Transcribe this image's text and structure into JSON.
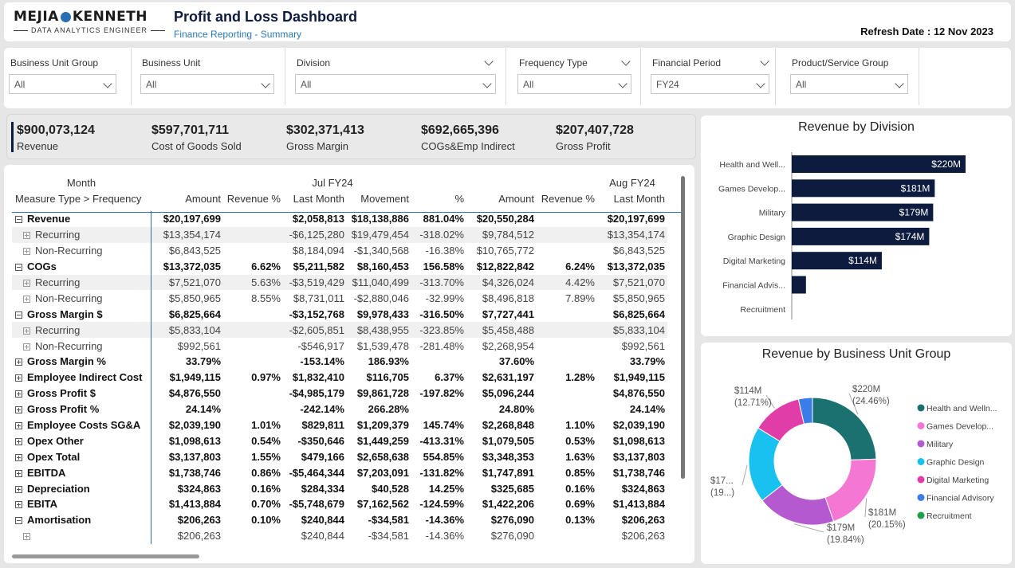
{
  "header": {
    "logo_main_left": "MEJIA",
    "logo_main_right": "KENNETH",
    "logo_sub": "DATA ANALYTICS ENGINEER",
    "title": "Profit and Loss Dashboard",
    "subtitle": "Finance Reporting - Summary",
    "refresh_label": "Refresh Date :",
    "refresh_value": "12 Nov 2023"
  },
  "slicers": [
    {
      "label": "Business Unit Group",
      "value": "All"
    },
    {
      "label": "Business Unit",
      "value": "All"
    },
    {
      "label": "Division",
      "value": "All"
    },
    {
      "label": "Frequency Type",
      "value": "All"
    },
    {
      "label": "Financial Period",
      "value": "FY24"
    },
    {
      "label": "Product/Service Group",
      "value": "All"
    }
  ],
  "kpis": [
    {
      "value": "$900,073,124",
      "label": "Revenue"
    },
    {
      "value": "$597,701,711",
      "label": "Cost of Goods Sold"
    },
    {
      "value": "$302,371,413",
      "label": "Gross Margin"
    },
    {
      "value": "$692,665,396",
      "label": "COGs&Emp Indirect"
    },
    {
      "value": "$207,407,728",
      "label": "Gross Profit"
    }
  ],
  "matrix": {
    "row_header_1": "Month",
    "row_header_2": "Measure Type > Frequency",
    "period_1": "Jul FY24",
    "period_2": "Aug FY24",
    "columns": [
      "Amount",
      "Revenue %",
      "Last Month",
      "Movement",
      "%",
      "Amount",
      "Revenue %",
      "Last Month"
    ],
    "rows": [
      {
        "label": "Revenue",
        "type": "bold",
        "exp": "minus",
        "cells": [
          "$20,197,699",
          "",
          "$2,058,813",
          "$18,138,886",
          "881.04%",
          "$20,550,284",
          "",
          "$20,197,699"
        ]
      },
      {
        "label": "Recurring",
        "type": "child",
        "cells": [
          "$13,354,174",
          "",
          "-$6,125,280",
          "$19,479,454",
          "-318.02%",
          "$9,784,512",
          "",
          "$13,354,174"
        ]
      },
      {
        "label": "Non-Recurring",
        "type": "child alt",
        "cells": [
          "$6,843,525",
          "",
          "$8,184,094",
          "-$1,340,568",
          "-16.38%",
          "$10,765,772",
          "",
          "$6,843,525"
        ]
      },
      {
        "label": "COGs",
        "type": "bold",
        "exp": "minus",
        "cells": [
          "$13,372,035",
          "6.62%",
          "$5,211,582",
          "$8,160,453",
          "156.58%",
          "$12,822,842",
          "6.24%",
          "$13,372,035"
        ]
      },
      {
        "label": "Recurring",
        "type": "child",
        "cells": [
          "$7,521,070",
          "5.63%",
          "-$3,519,429",
          "$11,040,499",
          "-313.70%",
          "$4,326,024",
          "4.42%",
          "$7,521,070"
        ]
      },
      {
        "label": "Non-Recurring",
        "type": "child alt",
        "cells": [
          "$5,850,965",
          "8.55%",
          "$8,731,011",
          "-$2,880,046",
          "-32.99%",
          "$8,496,818",
          "7.89%",
          "$5,850,965"
        ]
      },
      {
        "label": "Gross Margin $",
        "type": "bold",
        "exp": "minus",
        "cells": [
          "$6,825,664",
          "",
          "-$3,152,768",
          "$9,978,433",
          "-316.50%",
          "$7,727,441",
          "",
          "$6,825,664"
        ]
      },
      {
        "label": "Recurring",
        "type": "child",
        "cells": [
          "$5,833,104",
          "",
          "-$2,605,851",
          "$8,438,955",
          "-323.85%",
          "$5,458,488",
          "",
          "$5,833,104"
        ]
      },
      {
        "label": "Non-Recurring",
        "type": "child alt",
        "cells": [
          "$992,561",
          "",
          "-$546,917",
          "$1,539,478",
          "-281.48%",
          "$2,268,954",
          "",
          "$992,561"
        ]
      },
      {
        "label": "Gross Margin %",
        "type": "bold",
        "exp": "plus",
        "cells": [
          "33.79%",
          "",
          "-153.14%",
          "186.93%",
          "",
          "37.60%",
          "",
          "33.79%"
        ]
      },
      {
        "label": "Employee Indirect Cost",
        "type": "bold",
        "exp": "plus",
        "cells": [
          "$1,949,115",
          "0.97%",
          "$1,832,410",
          "$116,705",
          "6.37%",
          "$2,631,197",
          "1.28%",
          "$1,949,115"
        ]
      },
      {
        "label": "Gross Profit $",
        "type": "bold",
        "exp": "plus",
        "cells": [
          "$4,876,550",
          "",
          "-$4,985,179",
          "$9,861,728",
          "-197.82%",
          "$5,096,244",
          "",
          "$4,876,550"
        ]
      },
      {
        "label": "Gross Profit %",
        "type": "bold",
        "exp": "plus",
        "cells": [
          "24.14%",
          "",
          "-242.14%",
          "266.28%",
          "",
          "24.80%",
          "",
          "24.14%"
        ]
      },
      {
        "label": "Employee Costs SG&A",
        "type": "bold",
        "exp": "plus",
        "cells": [
          "$2,039,190",
          "1.01%",
          "$829,811",
          "$1,209,379",
          "145.74%",
          "$2,268,848",
          "1.10%",
          "$2,039,190"
        ]
      },
      {
        "label": "Opex Other",
        "type": "bold",
        "exp": "plus",
        "cells": [
          "$1,098,613",
          "0.54%",
          "-$350,646",
          "$1,449,259",
          "-413.31%",
          "$1,079,505",
          "0.53%",
          "$1,098,613"
        ]
      },
      {
        "label": "Opex Total",
        "type": "bold",
        "exp": "plus",
        "cells": [
          "$3,137,803",
          "1.55%",
          "$479,166",
          "$2,658,638",
          "554.85%",
          "$3,348,353",
          "1.63%",
          "$3,137,803"
        ]
      },
      {
        "label": "EBITDA",
        "type": "bold",
        "exp": "plus",
        "cells": [
          "$1,738,746",
          "0.86%",
          "-$5,464,344",
          "$7,203,091",
          "-131.82%",
          "$1,747,891",
          "0.85%",
          "$1,738,746"
        ]
      },
      {
        "label": "Depreciation",
        "type": "bold",
        "exp": "plus",
        "cells": [
          "$324,863",
          "0.16%",
          "$284,334",
          "$40,528",
          "14.25%",
          "$325,685",
          "0.16%",
          "$324,863"
        ]
      },
      {
        "label": "EBITA",
        "type": "bold",
        "exp": "plus",
        "cells": [
          "$1,413,884",
          "0.70%",
          "-$5,748,679",
          "$7,162,562",
          "-124.59%",
          "$1,422,206",
          "0.69%",
          "$1,413,884"
        ]
      },
      {
        "label": "Amortisation",
        "type": "bold",
        "exp": "minus",
        "cells": [
          "$206,263",
          "0.10%",
          "$240,844",
          "-$34,581",
          "-14.36%",
          "$276,090",
          "0.13%",
          "$206,263"
        ]
      },
      {
        "label": "",
        "type": "child alt",
        "cells": [
          "$206,263",
          "",
          "$240,844",
          "-$34,581",
          "-14.36%",
          "$276,090",
          "",
          "$206,263"
        ]
      }
    ]
  },
  "chart_data": [
    {
      "type": "bar",
      "title": "Revenue by Division",
      "categories": [
        "Health and Well...",
        "Games Develop...",
        "Military",
        "Graphic Design",
        "Digital Marketing",
        "Financial Advis...",
        "Recruitment"
      ],
      "values": [
        220,
        181,
        179,
        174,
        114,
        18,
        0
      ],
      "data_labels": [
        "$220M",
        "$181M",
        "$179M",
        "$174M",
        "$114M",
        "",
        ""
      ],
      "color": "#0d1b3e",
      "grid": false
    },
    {
      "type": "pie",
      "title": "Revenue by Business Unit Group",
      "categories": [
        "Health and Welln...",
        "Games Develop...",
        "Military",
        "Graphic Design",
        "Digital Marketing",
        "Financial Advisory",
        "Recruitment"
      ],
      "values": [
        24.46,
        20.15,
        19.84,
        19.3,
        12.71,
        3.54,
        0
      ],
      "colors": [
        "#1b7070",
        "#f477d4",
        "#b559d0",
        "#18c1ef",
        "#e03da8",
        "#3b7de8",
        "#1ea04a"
      ],
      "labels": [
        {
          "value": "$220M",
          "pct": "(24.46%)"
        },
        {
          "value": "$181M",
          "pct": "(20.15%)"
        },
        {
          "value": "$179M",
          "pct": "(19.84%)"
        },
        {
          "value": "$17...",
          "pct": "(19...)"
        },
        {
          "value": "$114M",
          "pct": "(12.71%)"
        }
      ],
      "legend_position": "right"
    }
  ]
}
